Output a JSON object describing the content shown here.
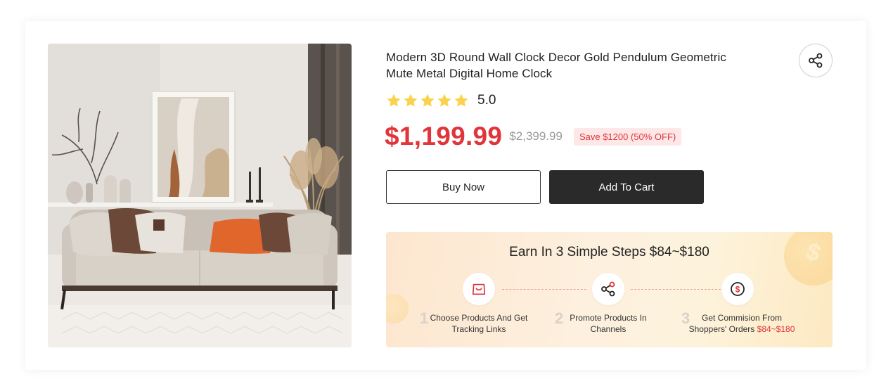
{
  "product": {
    "title_line1": "Modern 3D Round Wall Clock Decor Gold Pendulum Geometric",
    "title_line2": "Mute Metal Digital Home Clock",
    "rating_value": "5.0",
    "rating_stars": 5,
    "price": "$1,199.99",
    "original_price": "$2,399.99",
    "save_text": "Save $1200 (50% OFF)"
  },
  "actions": {
    "buy_now_label": "Buy Now",
    "add_to_cart_label": "Add To Cart",
    "share_icon": "share-icon"
  },
  "earn": {
    "title": "Earn In 3 Simple Steps $84~$180",
    "steps": [
      {
        "number": "1",
        "icon": "shopping-bag-icon",
        "line1": "Choose Products And Get",
        "line2": "Tracking Links"
      },
      {
        "number": "2",
        "icon": "share-icon",
        "line1": "Promote Products In",
        "line2": "Channels"
      },
      {
        "number": "3",
        "icon": "dollar-coin-icon",
        "line1": "Get Commision From",
        "line2_prefix": "Shoppers' Orders",
        "line2_highlight": "$84~$180"
      }
    ]
  },
  "colors": {
    "price": "#e0353b",
    "star": "#fbd24d",
    "cart_button": "#2a2a2a",
    "earn_bg": "#fdf0de"
  }
}
